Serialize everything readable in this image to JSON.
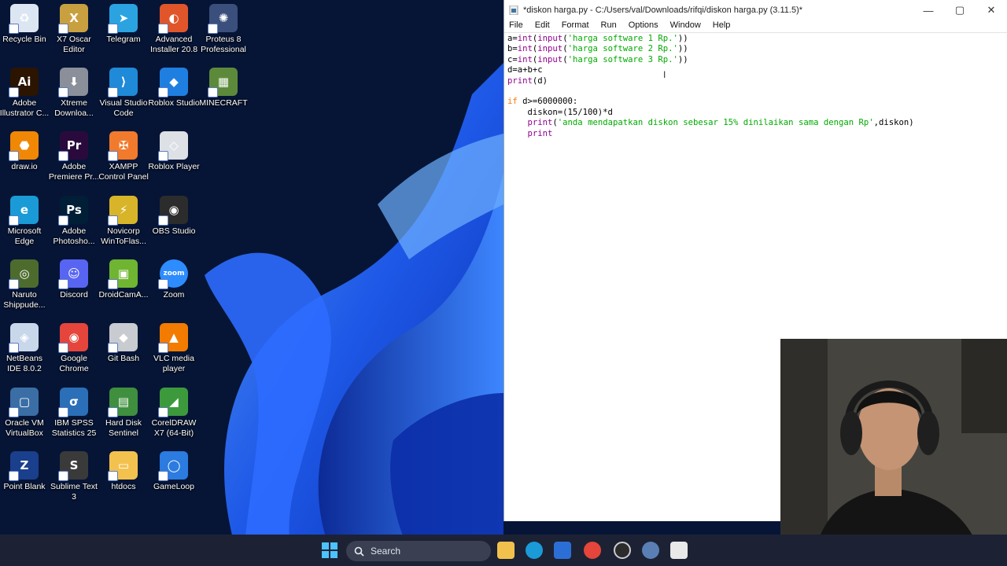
{
  "desktop": {
    "icons": [
      {
        "label": "Recycle Bin",
        "icon": "recycle-bin-icon",
        "color": "#dce6f2",
        "glyph": "♻"
      },
      {
        "label": "X7 Oscar Editor",
        "icon": "oscar-editor-icon",
        "color": "#c9a040",
        "glyph": "X"
      },
      {
        "label": "Telegram",
        "icon": "telegram-icon",
        "color": "#2aa3e0",
        "glyph": "➤"
      },
      {
        "label": "Advanced Installer 20.8",
        "icon": "advanced-installer-icon",
        "color": "#e0562a",
        "glyph": "◐"
      },
      {
        "label": "Proteus 8 Professional",
        "icon": "proteus-icon",
        "color": "#3a4f7c",
        "glyph": "✺"
      },
      {
        "label": "Adobe Illustrator C...",
        "icon": "illustrator-icon",
        "color": "#2b1400",
        "glyph": "Ai"
      },
      {
        "label": "Xtreme Downloa...",
        "icon": "xtreme-download-icon",
        "color": "#8a8f99",
        "glyph": "⬇"
      },
      {
        "label": "Visual Studio Code",
        "icon": "vscode-icon",
        "color": "#1f8ad8",
        "glyph": "⟩"
      },
      {
        "label": "Roblox Studio",
        "icon": "roblox-studio-icon",
        "color": "#1f7fe0",
        "glyph": "◆"
      },
      {
        "label": "MINECRAFT",
        "icon": "minecraft-icon",
        "color": "#5c8a3a",
        "glyph": "▦"
      },
      {
        "label": "draw.io",
        "icon": "drawio-icon",
        "color": "#f08705",
        "glyph": "⬣"
      },
      {
        "label": "Adobe Premiere Pr...",
        "icon": "premiere-icon",
        "color": "#2a0a3c",
        "glyph": "Pr"
      },
      {
        "label": "XAMPP Control Panel",
        "icon": "xampp-icon",
        "color": "#f17a2c",
        "glyph": "✠"
      },
      {
        "label": "Roblox Player",
        "icon": "roblox-player-icon",
        "color": "#dde0e5",
        "glyph": "◇"
      },
      {
        "label": "Microsoft Edge",
        "icon": "edge-icon",
        "color": "#1a9bd7",
        "glyph": "e"
      },
      {
        "label": "Adobe Photosho...",
        "icon": "photoshop-icon",
        "color": "#001e36",
        "glyph": "Ps"
      },
      {
        "label": "Novicorp WinToFlas...",
        "icon": "wintoflash-icon",
        "color": "#d8b528",
        "glyph": "⚡"
      },
      {
        "label": "OBS Studio",
        "icon": "obs-icon",
        "color": "#2c2c2c",
        "glyph": "◉"
      },
      {
        "label": "Naruto Shippude...",
        "icon": "naruto-icon",
        "color": "#4d6b2d",
        "glyph": "◎"
      },
      {
        "label": "Discord",
        "icon": "discord-icon",
        "color": "#5865f2",
        "glyph": "☺"
      },
      {
        "label": "DroidCamA...",
        "icon": "droidcam-icon",
        "color": "#6fb531",
        "glyph": "▣"
      },
      {
        "label": "Zoom",
        "icon": "zoom-icon",
        "color": "#2d8cff",
        "glyph": "zoom"
      },
      {
        "label": "NetBeans IDE 8.0.2",
        "icon": "netbeans-icon",
        "color": "#c9d7ea",
        "glyph": "◈"
      },
      {
        "label": "Google Chrome",
        "icon": "chrome-icon",
        "color": "#e5453b",
        "glyph": "◉"
      },
      {
        "label": "Git Bash",
        "icon": "git-bash-icon",
        "color": "#c8cbd0",
        "glyph": "◆"
      },
      {
        "label": "VLC media player",
        "icon": "vlc-icon",
        "color": "#f27b00",
        "glyph": "▲"
      },
      {
        "label": "Oracle VM VirtualBox",
        "icon": "virtualbox-icon",
        "color": "#3a6ea5",
        "glyph": "▢"
      },
      {
        "label": "IBM SPSS Statistics 25",
        "icon": "spss-icon",
        "color": "#2a6fb7",
        "glyph": "σ"
      },
      {
        "label": "Hard Disk Sentinel",
        "icon": "hard-disk-sentinel-icon",
        "color": "#3f8f3f",
        "glyph": "▤"
      },
      {
        "label": "CorelDRAW X7 (64-Bit)",
        "icon": "coreldraw-icon",
        "color": "#3c9a3c",
        "glyph": "◢"
      },
      {
        "label": "Point Blank",
        "icon": "point-blank-icon",
        "color": "#1a3f8c",
        "glyph": "Z"
      },
      {
        "label": "Sublime Text 3",
        "icon": "sublime-text-icon",
        "color": "#3a3a3a",
        "glyph": "S"
      },
      {
        "label": "htdocs",
        "icon": "folder-icon",
        "color": "#f3c24e",
        "glyph": "▭"
      },
      {
        "label": "GameLoop",
        "icon": "gameloop-icon",
        "color": "#2b7be0",
        "glyph": "◯"
      }
    ]
  },
  "idle_window": {
    "title": "*diskon harga.py - C:/Users/val/Downloads/rifqi/diskon harga.py (3.11.5)*",
    "menu": [
      "File",
      "Edit",
      "Format",
      "Run",
      "Options",
      "Window",
      "Help"
    ],
    "code_lines": [
      "a=int(input('harga software 1 Rp.'))",
      "b=int(input('harga software 2 Rp.'))",
      "c=int(input('harga software 3 Rp.'))",
      "d=a+b+c",
      "print(d)",
      "",
      "if d>=6000000:",
      "    diskon=(15/100)*d",
      "    print('anda mendapatkan diskon sebesar 15% dinilaikan sama dengan Rp',diskon)",
      "    print"
    ]
  },
  "taskbar": {
    "search_label": "Search"
  },
  "colors": {
    "accent": "#1a5cff",
    "taskbar": "#1c2234",
    "desktop": "#061536"
  }
}
